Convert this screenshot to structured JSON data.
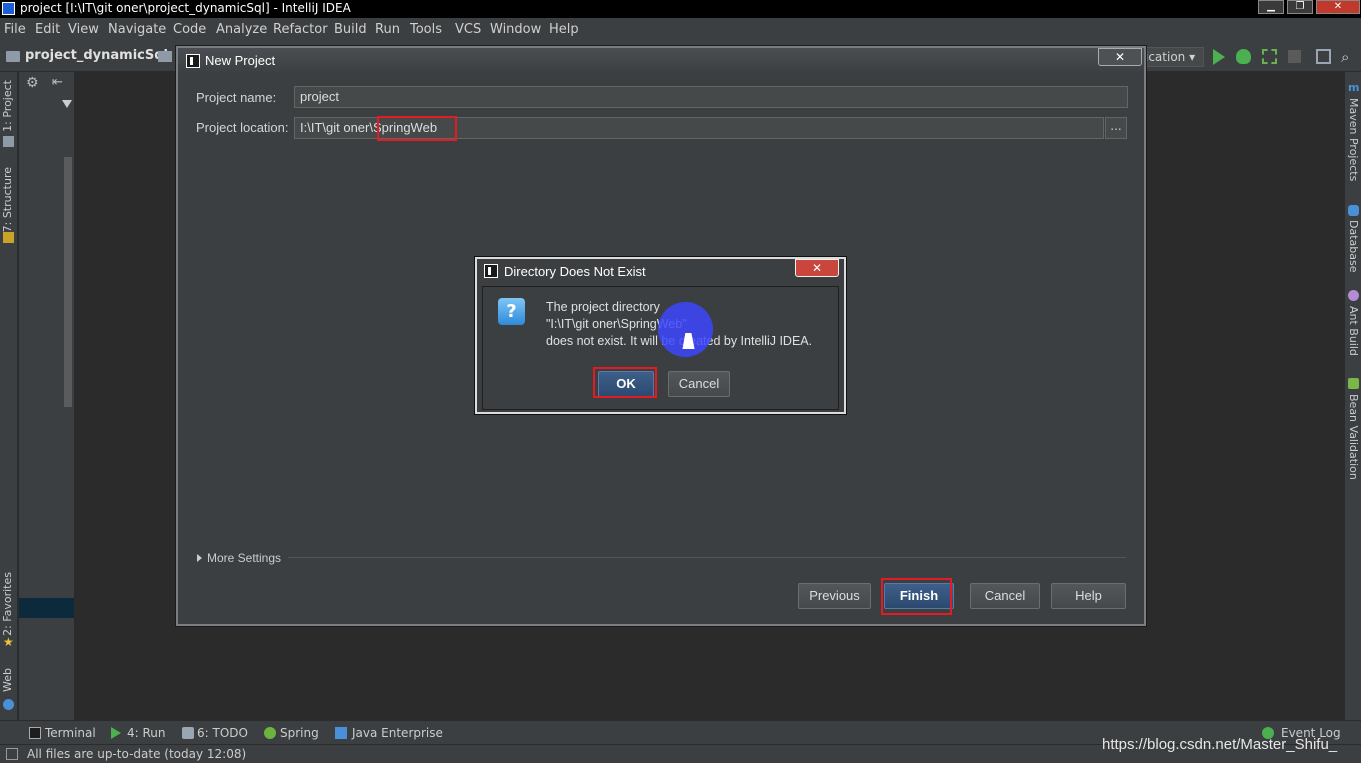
{
  "window": {
    "title": "project [I:\\IT\\git oner\\project_dynamicSql] - IntelliJ IDEA",
    "minimize": "▁",
    "restore": "❐",
    "close": "✕"
  },
  "menu": [
    "File",
    "Edit",
    "View",
    "Navigate",
    "Code",
    "Analyze",
    "Refactor",
    "Build",
    "Run",
    "Tools",
    "VCS",
    "Window",
    "Help"
  ],
  "navbar": {
    "breadcrumb": "project_dynamicSql",
    "run_config": "ication ▾"
  },
  "left_tabs": [
    "1: Project",
    "7: Structure",
    "2: Favorites",
    "Web"
  ],
  "right_tabs": [
    "Maven Projects",
    "Database",
    "Ant Build",
    "Bean Validation"
  ],
  "bottom_tabs": [
    "Terminal",
    "4: Run",
    "6: TODO",
    "Spring",
    "Java Enterprise",
    "Event Log"
  ],
  "status": {
    "text": "All files are up-to-date (today 12:08)",
    "watermark": "https://blog.csdn.net/Master_Shifu_"
  },
  "new_project_dialog": {
    "title": "New Project",
    "close": "✕",
    "project_name_label": "Project name:",
    "project_name_value": "project",
    "project_location_label": "Project location:",
    "project_location_value": "I:\\IT\\git oner\\SpringWeb",
    "browse": "...",
    "more_settings": "More Settings",
    "buttons": {
      "previous": "Previous",
      "finish": "Finish",
      "cancel": "Cancel",
      "help": "Help"
    }
  },
  "directory_dialog": {
    "title": "Directory Does Not Exist",
    "close": "✕",
    "icon": "?",
    "message_lines": [
      "The project directory",
      "\"I:\\IT\\git oner\\SpringWeb\"",
      "does not exist. It will be created by IntelliJ IDEA."
    ],
    "ok": "OK",
    "cancel": "Cancel"
  },
  "colors": {
    "highlight_red": "#e41b23",
    "cursor_blue": "#3c46ff",
    "background": "#2b2b2b",
    "panel": "#3c3f41"
  }
}
